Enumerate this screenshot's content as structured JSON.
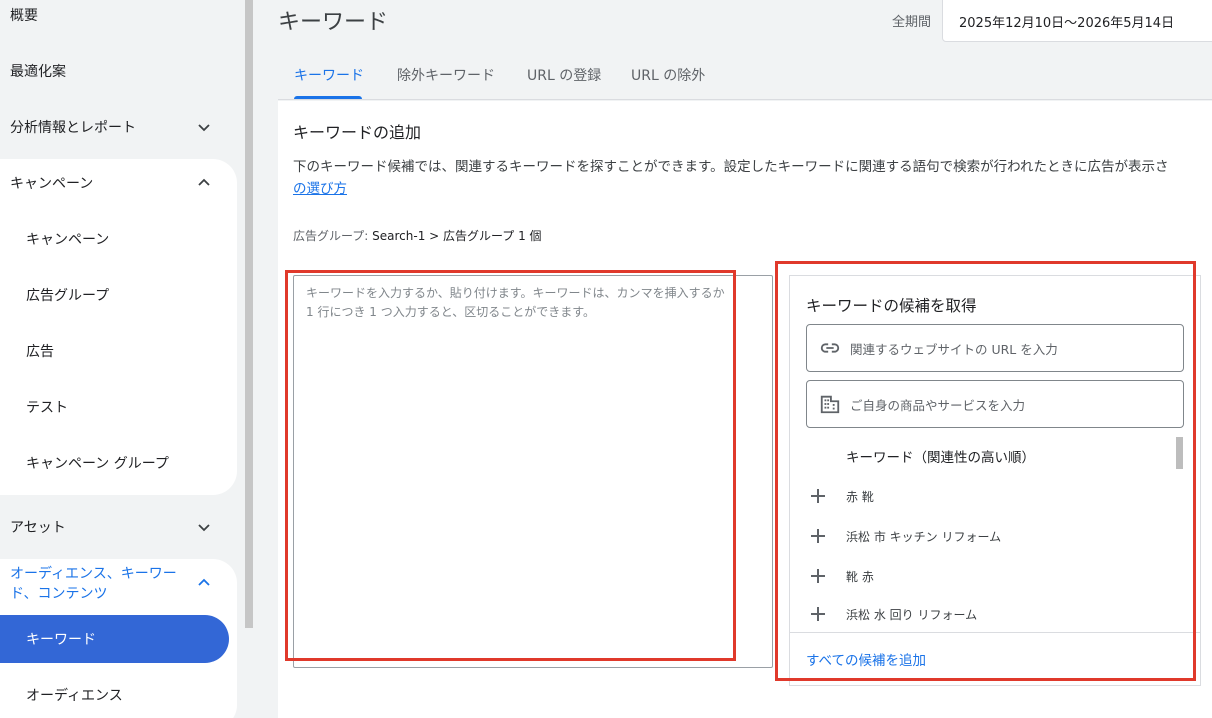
{
  "sidebar": {
    "items": [
      {
        "label": "概要"
      },
      {
        "label": "最適化案"
      },
      {
        "label": "分析情報とレポート"
      },
      {
        "label": "キャンペーン"
      },
      {
        "label": "キャンペーン"
      },
      {
        "label": "広告グループ"
      },
      {
        "label": "広告"
      },
      {
        "label": "テスト"
      },
      {
        "label": "キャンペーン グループ"
      },
      {
        "label": "アセット"
      },
      {
        "label": "オーディエンス、キーワード、コンテンツ"
      },
      {
        "label": "キーワード"
      },
      {
        "label": "オーディエンス"
      }
    ]
  },
  "header": {
    "title": "キーワード",
    "period_label": "全期間",
    "date_range": "2025年12月10日〜2026年5月14日"
  },
  "tabs": [
    {
      "label": "キーワード"
    },
    {
      "label": "除外キーワード"
    },
    {
      "label": "URL の登録"
    },
    {
      "label": "URL の除外"
    }
  ],
  "add_section": {
    "title": "キーワードの追加",
    "description": "下のキーワード候補では、関連するキーワードを探すことができます。設定したキーワードに関連する語句で検索が行われたときに広告が表示さ",
    "link": "の選び方",
    "ad_group_label": "広告グループ: ",
    "ad_group_value": "Search-1 > 広告グループ 1 個",
    "textarea_placeholder_1": "キーワードを入力するか、貼り付けます。キーワードは、カンマを挿入するか",
    "textarea_placeholder_2": "1 行につき 1 つ入力すると、区切ることができます。"
  },
  "suggestions": {
    "title": "キーワードの候補を取得",
    "url_placeholder": "関連するウェブサイトの URL を入力",
    "product_placeholder": "ご自身の商品やサービスを入力",
    "list_header": "キーワード（関連性の高い順）",
    "keywords": [
      "赤 靴",
      "浜松 市 キッチン リフォーム",
      "靴 赤",
      "浜松 水 回り リフォーム"
    ],
    "add_all": "すべての候補を追加"
  },
  "colors": {
    "accent": "#1a73e8",
    "active_pill": "#3367d6",
    "highlight_box": "#e0392b"
  }
}
